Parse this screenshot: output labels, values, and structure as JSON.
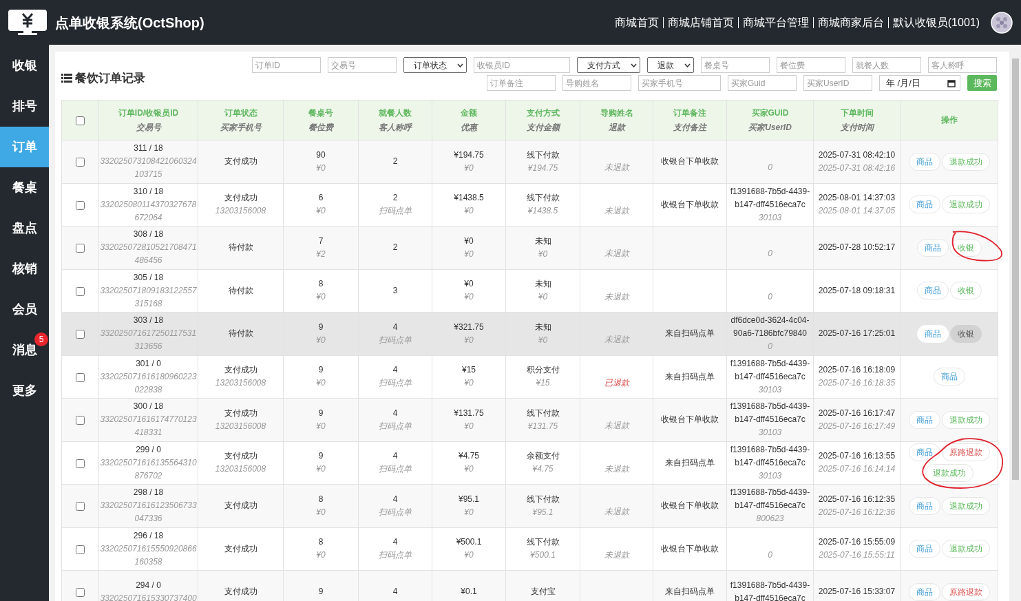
{
  "header": {
    "title": "点单收银系统(OctShop)",
    "links": [
      "商城首页",
      "商城店铺首页",
      "商城平台管理",
      "商城商家后台",
      "默认收银员(1001)"
    ]
  },
  "nav": [
    {
      "label": "收银",
      "selected": false
    },
    {
      "label": "排号",
      "selected": false
    },
    {
      "label": "订单",
      "selected": true
    },
    {
      "label": "餐桌",
      "selected": false
    },
    {
      "label": "盘点",
      "selected": false
    },
    {
      "label": "核销",
      "selected": false
    },
    {
      "label": "会员",
      "selected": false
    },
    {
      "label": "消息",
      "selected": false,
      "badge": "5"
    },
    {
      "label": "更多",
      "selected": false
    }
  ],
  "panel_title": "餐饮订单记录",
  "filters": {
    "row_1": [
      {
        "kind": "input",
        "placeholder": "订单ID"
      },
      {
        "kind": "input",
        "placeholder": "交易号"
      },
      {
        "kind": "select",
        "label": "订单状态"
      },
      {
        "kind": "input",
        "placeholder": "收银员ID"
      },
      {
        "kind": "select",
        "label": "支付方式"
      },
      {
        "kind": "select",
        "label": "退款"
      },
      {
        "kind": "input",
        "placeholder": "餐桌号"
      },
      {
        "kind": "input",
        "placeholder": "餐位费"
      },
      {
        "kind": "input",
        "placeholder": "就餐人数"
      },
      {
        "kind": "input",
        "placeholder": "客人称呼"
      }
    ],
    "row_2": [
      {
        "kind": "input",
        "placeholder": "订单备注"
      },
      {
        "kind": "input",
        "placeholder": "导购姓名"
      },
      {
        "kind": "input",
        "placeholder": "买家手机号"
      },
      {
        "kind": "input",
        "placeholder": "买家Guid"
      },
      {
        "kind": "input",
        "placeholder": "买家UserID"
      },
      {
        "kind": "date",
        "value": "年 /月/日"
      },
      {
        "kind": "button",
        "label": "搜索"
      }
    ]
  },
  "table": {
    "select_all": {
      "checked": false
    },
    "columns": [
      {
        "title": "订单ID/收银员ID",
        "subtitle": "交易号"
      },
      {
        "title": "订单状态",
        "subtitle": "买家手机号"
      },
      {
        "title": "餐桌号",
        "subtitle": "餐位费"
      },
      {
        "title": "就餐人数",
        "subtitle": "客人称呼"
      },
      {
        "title": "金额",
        "subtitle": "优惠"
      },
      {
        "title": "支付方式",
        "subtitle": "支付金额"
      },
      {
        "title": "导购姓名",
        "subtitle": "退款"
      },
      {
        "title": "订单备注",
        "subtitle": "支付备注"
      },
      {
        "title": "买家GUID",
        "subtitle": "买家UserID"
      },
      {
        "title": "下单时间",
        "subtitle": "支付时间"
      },
      {
        "title": "操作"
      }
    ],
    "rows": [
      {
        "checked": false,
        "highlighted": false,
        "annotated": false,
        "cells": [
          {
            "main": "311 / 18",
            "sub": "332025073108421060324103715"
          },
          {
            "main": "支付成功"
          },
          {
            "main": "90",
            "sub": "¥0"
          },
          {
            "main": "2"
          },
          {
            "main": "¥194.75",
            "sub": "¥0"
          },
          {
            "main": "线下付款",
            "sub": "¥194.75"
          },
          {
            "sub": "未退款",
            "refunded": false
          },
          {
            "main": "收银台下单收款"
          },
          {
            "sub": "0"
          },
          {
            "main": "2025-07-31 08:42:10",
            "sub": "2025-07-31 08:42:16"
          }
        ],
        "actions": [
          {
            "kind": "goods",
            "label": "商品"
          },
          {
            "kind": "refund_done",
            "label": "退款成功"
          }
        ]
      },
      {
        "checked": false,
        "highlighted": false,
        "annotated": false,
        "cells": [
          {
            "main": "310 / 18",
            "sub": "332025080114370327678672064"
          },
          {
            "main": "支付成功",
            "sub": "13203156008"
          },
          {
            "main": "6",
            "sub": "¥0"
          },
          {
            "main": "2",
            "sub": "扫码点单"
          },
          {
            "main": "¥1438.5",
            "sub": "¥0"
          },
          {
            "main": "线下付款",
            "sub": "¥1438.5"
          },
          {
            "sub": "未退款",
            "refunded": false
          },
          {
            "main": "收银台下单收款"
          },
          {
            "main": "f1391688-7b5d-4439-b147-dff4516eca7c",
            "sub": "30103"
          },
          {
            "main": "2025-08-01 14:37:03",
            "sub": "2025-08-01 14:37:05"
          }
        ],
        "actions": [
          {
            "kind": "goods",
            "label": "商品"
          },
          {
            "kind": "refund_done",
            "label": "退款成功"
          }
        ]
      },
      {
        "checked": false,
        "highlighted": false,
        "annotated": true,
        "cells": [
          {
            "main": "308 / 18",
            "sub": "332025072810521708471486456"
          },
          {
            "main": "待付款"
          },
          {
            "main": "7",
            "sub": "¥2"
          },
          {
            "main": "2"
          },
          {
            "main": "¥0",
            "sub": "¥0"
          },
          {
            "main": "未知",
            "sub": "¥0"
          },
          {
            "sub": "未退款",
            "refunded": false
          },
          {},
          {
            "sub": "0"
          },
          {
            "main": "2025-07-28 10:52:17"
          }
        ],
        "actions": [
          {
            "kind": "goods",
            "label": "商品"
          },
          {
            "kind": "collect",
            "label": "收银"
          }
        ]
      },
      {
        "checked": false,
        "highlighted": false,
        "annotated": false,
        "cells": [
          {
            "main": "305 / 18",
            "sub": "332025071809183122557315168"
          },
          {
            "main": "待付款"
          },
          {
            "main": "8",
            "sub": "¥0"
          },
          {
            "main": "3"
          },
          {
            "main": "¥0",
            "sub": "¥0"
          },
          {
            "main": "未知",
            "sub": "¥0"
          },
          {
            "sub": "未退款",
            "refunded": false
          },
          {},
          {
            "sub": "0"
          },
          {
            "main": "2025-07-18 09:18:31"
          }
        ],
        "actions": [
          {
            "kind": "goods",
            "label": "商品"
          },
          {
            "kind": "collect",
            "label": "收银"
          }
        ]
      },
      {
        "checked": false,
        "highlighted": true,
        "annotated": false,
        "cells": [
          {
            "main": "303 / 18",
            "sub": "332025071617250117531313656"
          },
          {
            "main": "待付款"
          },
          {
            "main": "9",
            "sub": "¥0"
          },
          {
            "main": "4",
            "sub": "扫码点单"
          },
          {
            "main": "¥321.75",
            "sub": "¥0"
          },
          {
            "main": "未知",
            "sub": "¥0"
          },
          {
            "sub": "未退款",
            "refunded": false
          },
          {
            "main": "来自扫码点单"
          },
          {
            "main": "df6dce0d-3624-4c04-90a6-7186bfc79840",
            "sub": "0"
          },
          {
            "main": "2025-07-16 17:25:01"
          }
        ],
        "actions": [
          {
            "kind": "goods",
            "label": "商品"
          },
          {
            "kind": "collect",
            "label": "收银"
          }
        ]
      },
      {
        "checked": false,
        "highlighted": false,
        "annotated": false,
        "cells": [
          {
            "main": "301 / 0",
            "sub": "332025071616180960223022838"
          },
          {
            "main": "支付成功",
            "sub": "13203156008"
          },
          {
            "main": "9",
            "sub": "¥0"
          },
          {
            "main": "4",
            "sub": "扫码点单"
          },
          {
            "main": "¥15",
            "sub": "¥0"
          },
          {
            "main": "积分支付",
            "sub": "¥15"
          },
          {
            "sub": "已退款",
            "refunded": true
          },
          {
            "main": "来自扫码点单"
          },
          {
            "main": "f1391688-7b5d-4439-b147-dff4516eca7c",
            "sub": "30103"
          },
          {
            "main": "2025-07-16 16:18:09",
            "sub": "2025-07-16 16:18:35"
          }
        ],
        "actions": [
          {
            "kind": "goods",
            "label": "商品"
          }
        ]
      },
      {
        "checked": false,
        "highlighted": false,
        "annotated": false,
        "cells": [
          {
            "main": "300 / 18",
            "sub": "332025071616174770123418331"
          },
          {
            "main": "支付成功",
            "sub": "13203156008"
          },
          {
            "main": "9",
            "sub": "¥0"
          },
          {
            "main": "4",
            "sub": "扫码点单"
          },
          {
            "main": "¥131.75",
            "sub": "¥0"
          },
          {
            "main": "线下付款",
            "sub": "¥131.75"
          },
          {
            "sub": "未退款",
            "refunded": false
          },
          {
            "main": "收银台下单收款"
          },
          {
            "main": "f1391688-7b5d-4439-b147-dff4516eca7c",
            "sub": "30103"
          },
          {
            "main": "2025-07-16 16:17:47",
            "sub": "2025-07-16 16:17:49"
          }
        ],
        "actions": [
          {
            "kind": "goods",
            "label": "商品"
          },
          {
            "kind": "refund_done",
            "label": "退款成功"
          }
        ]
      },
      {
        "checked": false,
        "highlighted": false,
        "annotated": true,
        "cells": [
          {
            "main": "299 / 0",
            "sub": "332025071616135564310876702"
          },
          {
            "main": "支付成功",
            "sub": "13203156008"
          },
          {
            "main": "9",
            "sub": "¥0"
          },
          {
            "main": "4",
            "sub": "扫码点单"
          },
          {
            "main": "¥4.75",
            "sub": "¥0"
          },
          {
            "main": "余额支付",
            "sub": "¥4.75"
          },
          {
            "sub": "未退款",
            "refunded": false
          },
          {
            "main": "来自扫码点单"
          },
          {
            "main": "f1391688-7b5d-4439-b147-dff4516eca7c",
            "sub": "30103"
          },
          {
            "main": "2025-07-16 16:13:55",
            "sub": "2025-07-16 16:14:14"
          }
        ],
        "actions": [
          {
            "kind": "goods",
            "label": "商品"
          },
          {
            "kind": "refund_back",
            "label": "原路退款"
          },
          {
            "kind": "refund_done",
            "label": "退款成功"
          }
        ]
      },
      {
        "checked": false,
        "highlighted": false,
        "annotated": false,
        "cells": [
          {
            "main": "298 / 18",
            "sub": "332025071616123506733047336"
          },
          {
            "main": "支付成功"
          },
          {
            "main": "8",
            "sub": "¥0"
          },
          {
            "main": "4",
            "sub": "扫码点单"
          },
          {
            "main": "¥95.1",
            "sub": "¥0"
          },
          {
            "main": "线下付款",
            "sub": "¥95.1"
          },
          {
            "sub": "未退款",
            "refunded": false
          },
          {
            "main": "收银台下单收款"
          },
          {
            "main": "f1391688-7b5d-4439-b147-dff4516eca7c",
            "sub": "800623"
          },
          {
            "main": "2025-07-16 16:12:35",
            "sub": "2025-07-16 16:12:36"
          }
        ],
        "actions": [
          {
            "kind": "goods",
            "label": "商品"
          },
          {
            "kind": "refund_done",
            "label": "退款成功"
          }
        ]
      },
      {
        "checked": false,
        "highlighted": false,
        "annotated": false,
        "cells": [
          {
            "main": "296 / 18",
            "sub": "332025071615550920866160358"
          },
          {
            "main": "支付成功"
          },
          {
            "main": "8",
            "sub": "¥0"
          },
          {
            "main": "4",
            "sub": "扫码点单"
          },
          {
            "main": "¥500.1",
            "sub": "¥0"
          },
          {
            "main": "线下付款",
            "sub": "¥500.1"
          },
          {
            "sub": "未退款",
            "refunded": false
          },
          {
            "main": "收银台下单收款"
          },
          {
            "sub": "0"
          },
          {
            "main": "2025-07-16 15:55:09",
            "sub": "2025-07-16 15:55:11"
          }
        ],
        "actions": [
          {
            "kind": "goods",
            "label": "商品"
          },
          {
            "kind": "refund_done",
            "label": "退款成功"
          }
        ]
      },
      {
        "checked": false,
        "highlighted": false,
        "annotated": false,
        "cells": [
          {
            "main": "294 / 0",
            "sub": "332025071615330737400"
          },
          {
            "main": "支付成功"
          },
          {
            "main": "9"
          },
          {
            "main": "4"
          },
          {
            "main": "¥0.1"
          },
          {
            "main": "支付宝"
          },
          {},
          {
            "main": "来自扫码点单"
          },
          {
            "main": "f1391688-7b5d-4439-b147-dff4516eca7c"
          },
          {
            "main": "2025-07-16 15:33:07"
          }
        ],
        "actions": [
          {
            "kind": "goods",
            "label": "商品"
          },
          {
            "kind": "refund_back",
            "label": "原路退款"
          }
        ]
      }
    ]
  }
}
